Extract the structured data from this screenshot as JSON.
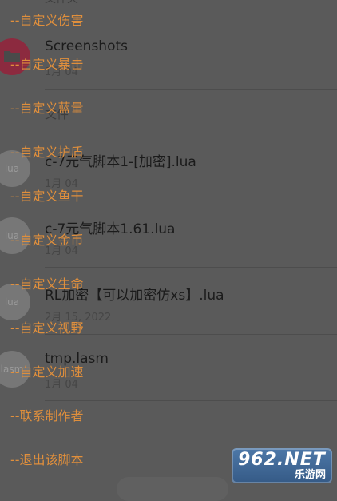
{
  "files": [
    {
      "name": "文件夹",
      "sub": "",
      "avatar": "",
      "type": "header"
    },
    {
      "name": "Screenshots",
      "sub": "1月 04",
      "avatar": "",
      "type": "folder"
    },
    {
      "name": "文件",
      "sub": "",
      "avatar": "",
      "type": "header"
    },
    {
      "name": "c-7元气脚本1-[加密].lua",
      "sub": "1月 04",
      "avatar": "lua",
      "type": "file"
    },
    {
      "name": "c-7元气脚本1.61.lua",
      "sub": "1月 04",
      "avatar": "lua",
      "type": "file"
    },
    {
      "name": "RL加密【可以加密仿xs】.lua",
      "sub": "2月 15, 2022",
      "avatar": "lua",
      "type": "file"
    },
    {
      "name": "tmp.lasm",
      "sub": "1月 04",
      "avatar": "lasm",
      "type": "file"
    }
  ],
  "menu": [
    "--自定义伤害",
    "--自定义暴击",
    "--自定义蓝量",
    "--自定义护盾",
    "--自定义鱼干",
    "--自定义金币",
    "--自定义生命",
    "--自定义视野",
    "--自定义加速",
    "--联系制作者",
    "--退出该脚本"
  ],
  "watermark": {
    "logo": "962.NET",
    "sub": "乐游网"
  },
  "colors": {
    "menu_text": "#e08f3c",
    "folder_avatar": "#8c2a3f"
  }
}
